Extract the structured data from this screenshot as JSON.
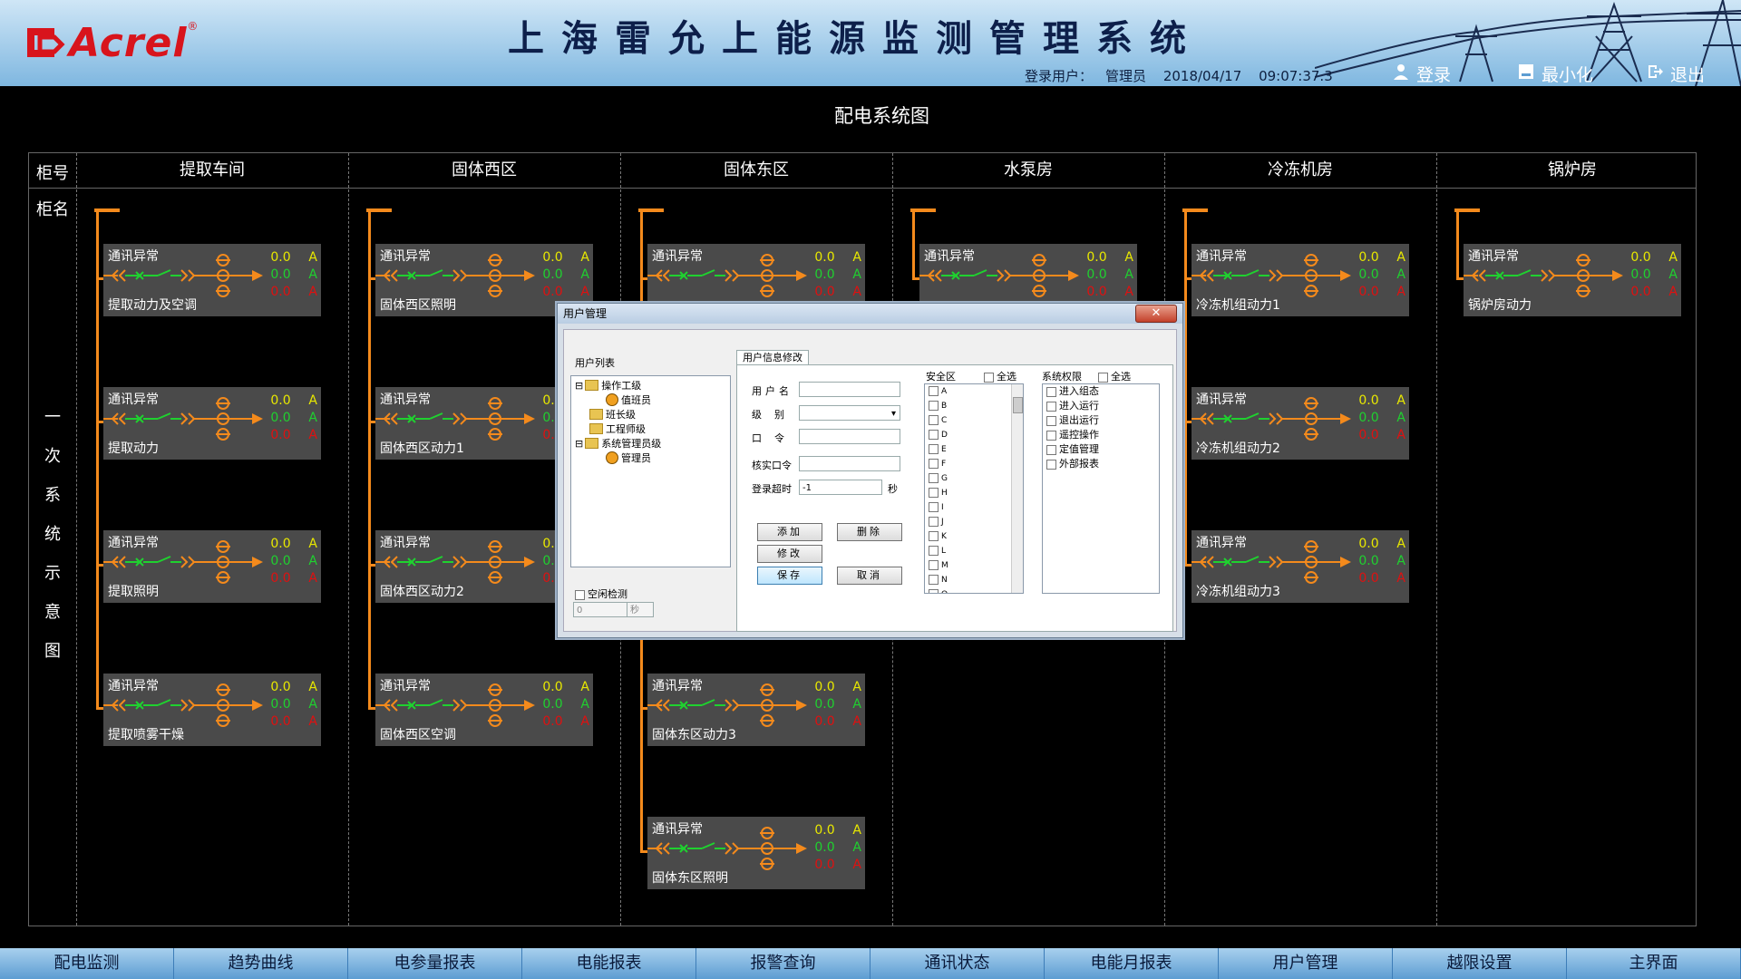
{
  "header": {
    "logo_text": "Acrel",
    "logo_reg": "®",
    "title": "上海雷允上能源监测管理系统",
    "login_label": "登录用户：",
    "login_user": "管理员",
    "date": "2018/04/17",
    "time": "09:07:37.3",
    "btn_login": "登录",
    "btn_minimize": "最小化",
    "btn_exit": "退出"
  },
  "page_title": "配电系统图",
  "grid": {
    "row_label_no": "柜号",
    "row_label_name": "柜名",
    "vertical_label": [
      "一",
      "次",
      "系",
      "统",
      "示",
      "意",
      "图"
    ],
    "columns": [
      {
        "name": "提取车间",
        "feeders": [
          {
            "status": "通讯异常",
            "name": "提取动力及空调",
            "v1": "0.0",
            "v2": "0.0",
            "v3": "0.0",
            "u1": "A",
            "u2": "A",
            "u3": "A"
          },
          {
            "status": "通讯异常",
            "name": "提取动力",
            "v1": "0.0",
            "v2": "0.0",
            "v3": "0.0",
            "u1": "A",
            "u2": "A",
            "u3": "A"
          },
          {
            "status": "通讯异常",
            "name": "提取照明",
            "v1": "0.0",
            "v2": "0.0",
            "v3": "0.0",
            "u1": "A",
            "u2": "A",
            "u3": "A"
          },
          {
            "status": "通讯异常",
            "name": "提取喷雾干燥",
            "v1": "0.0",
            "v2": "0.0",
            "v3": "0.0",
            "u1": "A",
            "u2": "A",
            "u3": "A"
          }
        ]
      },
      {
        "name": "固体西区",
        "feeders": [
          {
            "status": "通讯异常",
            "name": "固体西区照明",
            "v1": "0.0",
            "v2": "0.0",
            "v3": "0.0",
            "u1": "A",
            "u2": "A",
            "u3": "A"
          },
          {
            "status": "通讯异常",
            "name": "固体西区动力1",
            "v1": "0.0",
            "v2": "0.0",
            "v3": "0.0",
            "u1": "A",
            "u2": "A",
            "u3": "A"
          },
          {
            "status": "通讯异常",
            "name": "固体西区动力2",
            "v1": "0.0",
            "v2": "0.0",
            "v3": "0.0",
            "u1": "A",
            "u2": "A",
            "u3": "A"
          },
          {
            "status": "通讯异常",
            "name": "固体西区空调",
            "v1": "0.0",
            "v2": "0.0",
            "v3": "0.0",
            "u1": "A",
            "u2": "A",
            "u3": "A"
          }
        ]
      },
      {
        "name": "固体东区",
        "feeders": [
          {
            "status": "通讯异常",
            "name": "",
            "v1": "0.0",
            "v2": "0.0",
            "v3": "0.0",
            "u1": "A",
            "u2": "A",
            "u3": "A"
          },
          {
            "status": "通讯异常",
            "name": "固体东区动力3",
            "v1": "0.0",
            "v2": "0.0",
            "v3": "0.0",
            "u1": "A",
            "u2": "A",
            "u3": "A"
          },
          {
            "status": "通讯异常",
            "name": "固体东区照明",
            "v1": "0.0",
            "v2": "0.0",
            "v3": "0.0",
            "u1": "A",
            "u2": "A",
            "u3": "A"
          }
        ]
      },
      {
        "name": "水泵房",
        "feeders": [
          {
            "status": "通讯异常",
            "name": "",
            "v1": "0.0",
            "v2": "0.0",
            "v3": "0.0",
            "u1": "A",
            "u2": "A",
            "u3": "A"
          }
        ]
      },
      {
        "name": "冷冻机房",
        "feeders": [
          {
            "status": "通讯异常",
            "name": "冷冻机组动力1",
            "v1": "0.0",
            "v2": "0.0",
            "v3": "0.0",
            "u1": "A",
            "u2": "A",
            "u3": "A"
          },
          {
            "status": "通讯异常",
            "name": "冷冻机组动力2",
            "v1": "0.0",
            "v2": "0.0",
            "v3": "0.0",
            "u1": "A",
            "u2": "A",
            "u3": "A"
          },
          {
            "status": "通讯异常",
            "name": "冷冻机组动力3",
            "v1": "0.0",
            "v2": "0.0",
            "v3": "0.0",
            "u1": "A",
            "u2": "A",
            "u3": "A"
          }
        ]
      },
      {
        "name": "锅炉房",
        "feeders": [
          {
            "status": "通讯异常",
            "name": "锅炉房动力",
            "v1": "0.0",
            "v2": "0.0",
            "v3": "0.0",
            "u1": "A",
            "u2": "A",
            "u3": "A"
          }
        ]
      }
    ]
  },
  "dialog": {
    "title": "用户管理",
    "close": "✕",
    "user_list_label": "用户列表",
    "tree": [
      {
        "label": "操作工级",
        "type": "folder"
      },
      {
        "label": "值班员",
        "type": "user"
      },
      {
        "label": "班长级",
        "type": "folder"
      },
      {
        "label": "工程师级",
        "type": "folder"
      },
      {
        "label": "系统管理员级",
        "type": "folder"
      },
      {
        "label": "管理员",
        "type": "user"
      }
    ],
    "idle_check_label": "空闲检测",
    "idle_value": "0",
    "idle_unit": "秒",
    "tab_label": "用户信息修改",
    "fields": {
      "username_label": "用户名",
      "level_label": "级别",
      "password_label": "口令",
      "confirm_label": "核实口令",
      "timeout_label": "登录超时",
      "timeout_value": "-1",
      "timeout_unit": "秒"
    },
    "buttons": {
      "add": "添加",
      "delete": "删除",
      "modify": "修改",
      "save": "保存",
      "cancel": "取消"
    },
    "security_label": "安全区",
    "select_all": "全选",
    "security_items": [
      "A",
      "B",
      "C",
      "D",
      "E",
      "F",
      "G",
      "H",
      "I",
      "J",
      "K",
      "L",
      "M",
      "N",
      "O"
    ],
    "rights_label": "系统权限",
    "rights_items": [
      "进入组态",
      "进入运行",
      "退出运行",
      "遥控操作",
      "定值管理",
      "外部报表"
    ]
  },
  "nav": [
    "配电监测",
    "趋势曲线",
    "电参量报表",
    "电能报表",
    "报警查询",
    "通讯状态",
    "电能月报表",
    "用户管理",
    "越限设置",
    "主界面"
  ],
  "colors": {
    "bus": "#f48a1c",
    "green": "#1fd12f",
    "yellow": "#e8e800",
    "red": "#e01010"
  }
}
